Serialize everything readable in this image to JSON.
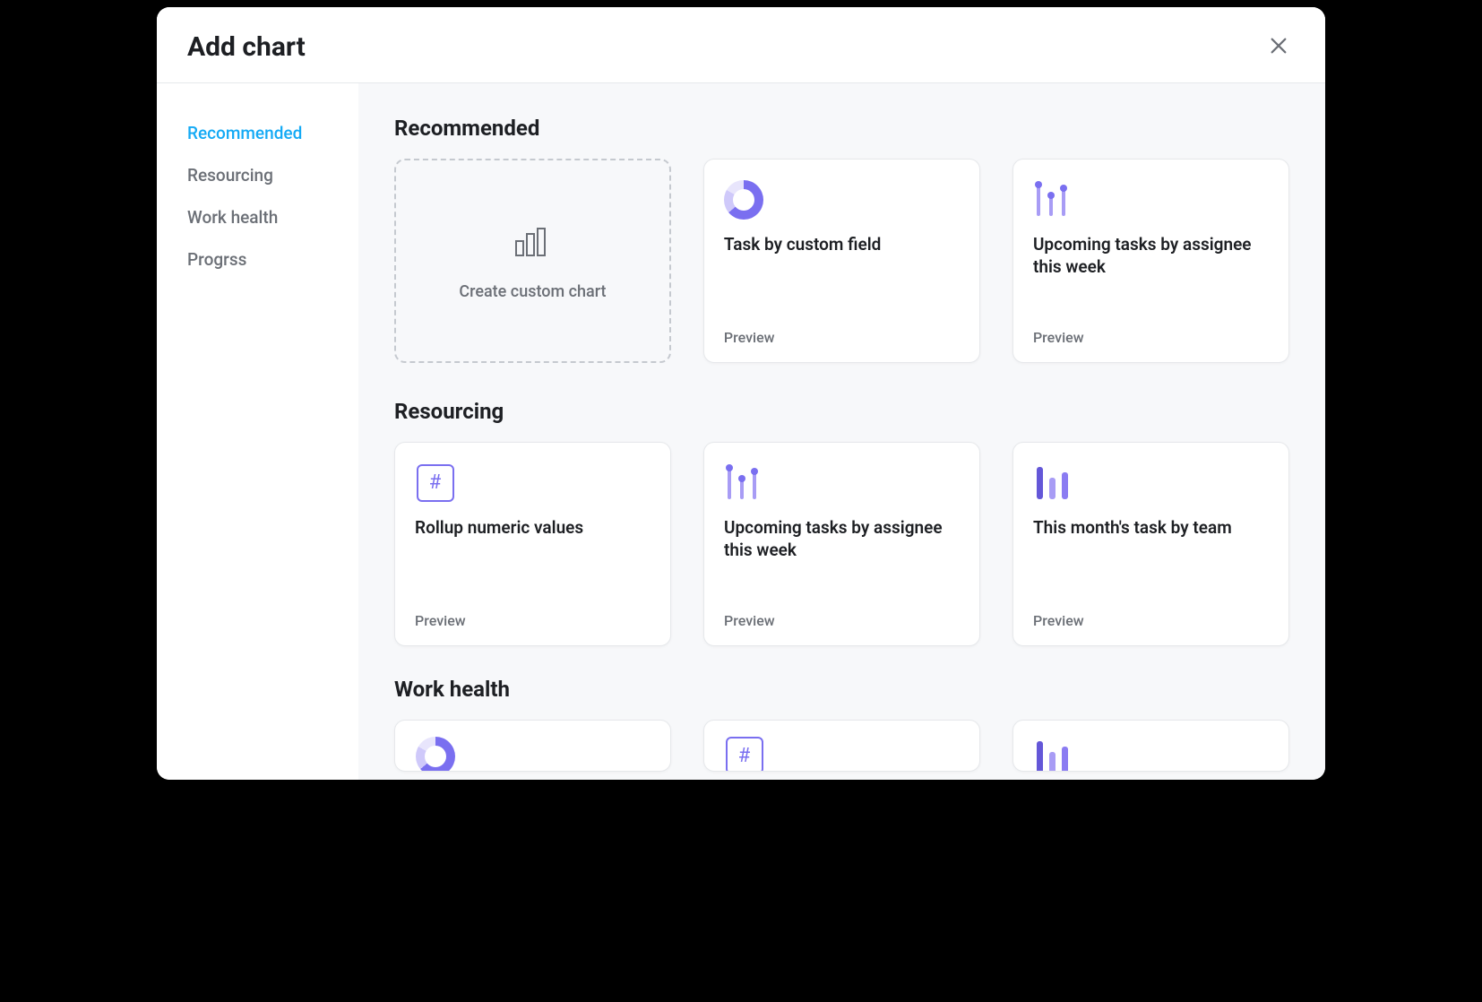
{
  "modal": {
    "title": "Add chart"
  },
  "sidebar": {
    "items": [
      {
        "label": "Recommended",
        "active": true
      },
      {
        "label": "Resourcing",
        "active": false
      },
      {
        "label": "Work health",
        "active": false
      },
      {
        "label": "Progrss",
        "active": false
      }
    ]
  },
  "sections": {
    "recommended": {
      "title": "Recommended",
      "create_label": "Create custom chart",
      "cards": [
        {
          "icon": "donut",
          "title": "Task by custom field",
          "preview_label": "Preview"
        },
        {
          "icon": "lollipop",
          "title": "Upcoming tasks by assignee this week",
          "preview_label": "Preview"
        }
      ]
    },
    "resourcing": {
      "title": "Resourcing",
      "cards": [
        {
          "icon": "hash",
          "title": "Rollup numeric values",
          "preview_label": "Preview"
        },
        {
          "icon": "lollipop",
          "title": "Upcoming tasks by assignee this week",
          "preview_label": "Preview"
        },
        {
          "icon": "bars",
          "title": "This month's task by team",
          "preview_label": "Preview"
        }
      ]
    },
    "work_health": {
      "title": "Work health",
      "cards": [
        {
          "icon": "donut"
        },
        {
          "icon": "hash"
        },
        {
          "icon": "bars"
        }
      ]
    }
  }
}
